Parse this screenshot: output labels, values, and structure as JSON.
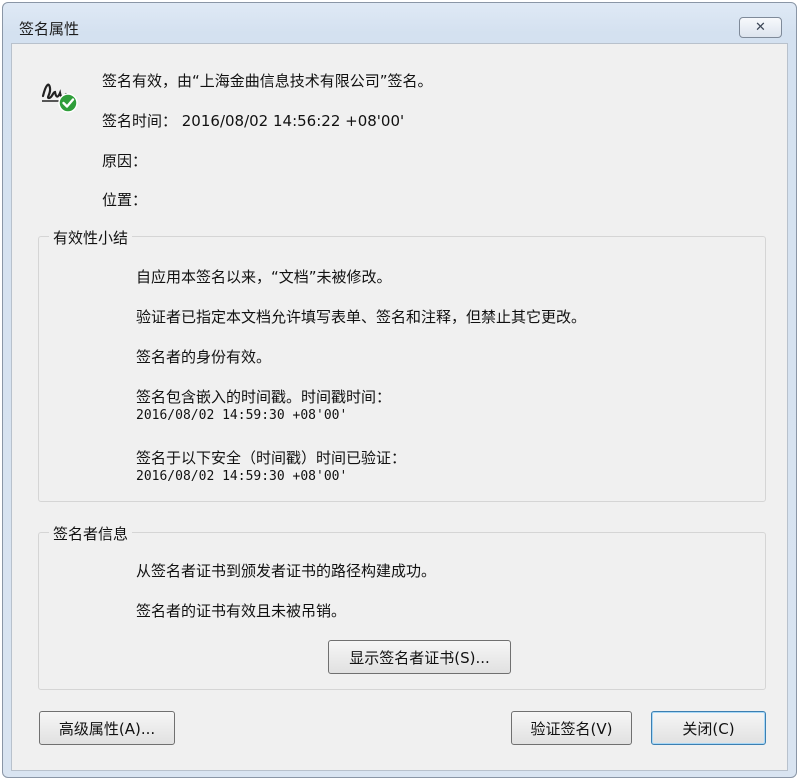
{
  "window": {
    "title": "签名属性",
    "close_glyph": "✕"
  },
  "summary": {
    "status": "签名有效，由“上海金曲信息技术有限公司”签名。",
    "signing_time": "签名时间： 2016/08/02 14:56:22 +08'00'",
    "reason": "原因：",
    "location": "位置："
  },
  "validity": {
    "label": "有效性小结",
    "lines": [
      "自应用本签名以来，“文档”未被修改。",
      "验证者已指定本文档允许填写表单、签名和注释，但禁止其它更改。",
      "签名者的身份有效。",
      "签名包含嵌入的时间戳。时间戳时间：",
      "签名于以下安全（时间戳）时间已验证："
    ],
    "timestamp_1": "2016/08/02 14:59:30 +08'00'",
    "timestamp_2": "2016/08/02 14:59:30 +08'00'"
  },
  "signer": {
    "label": "签名者信息",
    "lines": [
      "从签名者证书到颁发者证书的路径构建成功。",
      "签名者的证书有效且未被吊销。"
    ],
    "show_cert_button": "显示签名者证书(S)..."
  },
  "buttons": {
    "advanced": "高级属性(A)...",
    "verify": "验证签名(V)",
    "close": "关闭(C)"
  },
  "colors": {
    "check_green": "#2f9e3a",
    "titlebar": "#d4e1f0",
    "dialog_bg": "#f0f0f0"
  },
  "icons": {
    "signature": "signature-valid-icon",
    "close": "close-icon"
  }
}
